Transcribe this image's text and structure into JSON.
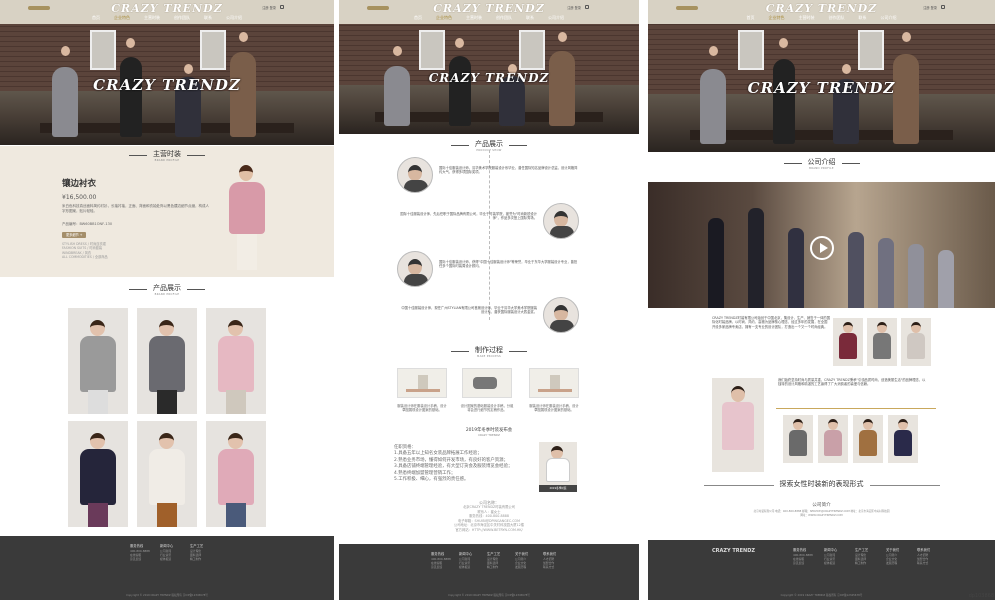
{
  "brand": "CRAZY TRENDZ",
  "nav": {
    "utility": "注册   登录",
    "items": [
      "首页",
      "企业特色",
      "主营时装",
      "创作团队",
      "联系",
      "公司介绍"
    ]
  },
  "hero_title": "CRAZY TRENDZ",
  "page1": {
    "main_section": {
      "title": "主营时装",
      "subtitle": "BRAND PROFILE"
    },
    "product": {
      "name": "镶边衬衣",
      "price": "¥16,500.00",
      "description": "米白色科技真丝面料简约衬衫，长袖衬袖，正面、背面和衣袖处饰以黑色镶边细节点缀，构成人字形图案，贴片轻轻。",
      "code": "产品编号：BW60BB1ONF-130",
      "button": "更多细节 +",
      "specs": "STYLISH DRESS / 时尚连衣裙\nFASHION SUITS / 时尚套装\nWINDBREAK / 风衣\nALL COMMODITIES / 全部商品"
    },
    "products_section": {
      "title": "产品展示",
      "subtitle": "BRAND PROFILE"
    }
  },
  "page2": {
    "products_section": {
      "title": "产品展示",
      "subtitle": "PRODUCT SHOW"
    },
    "items": [
      "国际十佳服装设计师，清华美术学院服装设计系毕业，曾任国际知名品牌设计总监，设计风格简约大气，获得多项国际奖项。",
      "国际十佳服装设计师，先后任职于国际品牌有限公司，毕业于时装学院，被誉为\"时尚新锐设计师\"，作品多次登上国际秀场。",
      "国际十佳服装设计师，获得\"中国十佳服装设计师\"等荣誉，毕业于东华大学服装设计专业，曾担任多个国际时装周设计顾问。",
      "中国十佳服装设计师，现任广州STYLIAN有限公司首席设计师，毕业于清华大学美术学院服装设计系，曾获国际服装设计大赛金奖。"
    ],
    "process_section": {
      "title": "制作过程",
      "subtitle": "MAKE PROCESS"
    },
    "process_captions": [
      "服装设计师在服装设计手稿，设计草图展现设计图案的基础。",
      "设计图案的基础服装设计手稿，分组将会进行细节的定稿作品。",
      "服装设计师在服装设计手稿，设计草图展现设计图案的基础。"
    ],
    "hiring": {
      "title": "2019年冬季时装发布会",
      "subtitle": "CRAZY TRENDZ",
      "lines": [
        "任职资格：",
        "1.具备五年以上知名女装品牌拓展工作经验；",
        "2.熟悉业务市场，懂得如何开发市场，有良好的客户资源；",
        "3.具备店铺终端管理经验，有大型订货会及服装博览会经验；",
        "4.熟悉终端加盟管理营销工作；",
        "5.工作积极、细心，有强烈的责任感。"
      ],
      "mini_caption": "2019冬季时装"
    },
    "contact": {
      "title": "公司名称：",
      "lines": [
        "北京CRAZY TRENDZ时装有限公司",
        "联系人：崔女士",
        "服务热线：400-800-8888",
        "电子邮箱：SHUIBI@DPINGANGEC.COM",
        "公司地址：北京市海淀区中关村科技园大厦12楼",
        "官方网站：HTTP://WWW.BETRYN.COM.HK/"
      ]
    }
  },
  "page3": {
    "about_section": {
      "title": "公司介绍",
      "subtitle": "BRAND PROFILE"
    },
    "about_text_1": "CRAZY TRENDZ时装有限公司始创于中国北京，集设计、生产、销售于一体的国际化时装品牌，以时尚、简约、高雅为品牌核心理念，经过多年的发展，在全国开设多家品牌专卖店，拥有一支专业的设计团队，打造出一个又一个时尚经典。",
    "about_text_2": "我们始终坚持时尚与质量并重，CRAZY TRENDZ秉承\"引领品质时尚，创造美丽生活\"的品牌理念，以独特的设计风格和精湛的工艺赢得了广大消费者的喜爱与信赖。",
    "explore": "探索女性时装新的表现形式",
    "company_info": "公司简介",
    "company_detail": "北京时装有限公司  电话：400-800-8888  邮箱：SERVICE@CRAZYTRENDZ.COM  地址：北京市海淀区中关村科技园\n网址：WWW.CRAZYTRENDZ.COM"
  },
  "footer": {
    "columns": [
      {
        "head": "服务热线",
        "links": [
          "400-800-8888",
          "在线客服",
          "意见反馈"
        ]
      },
      {
        "head": "新闻中心",
        "links": [
          "公司新闻",
          "行业资讯",
          "媒体报道"
        ]
      },
      {
        "head": "生产工艺",
        "links": [
          "设计理念",
          "面料选择",
          "精工制作"
        ]
      },
      {
        "head": "关于我们",
        "links": [
          "公司简介",
          "企业文化",
          "发展历程"
        ]
      },
      {
        "head": "联系我们",
        "links": [
          "人才招聘",
          "加盟合作",
          "联系方式"
        ]
      }
    ],
    "brand": "CRAZY TRENDZ",
    "copyright": "Copyright © 2019 CRAZY TRENDZ 版权所有  京ICP备12345678号"
  },
  "watermark": "dp103868",
  "colors": {
    "accent": "#a88c3c",
    "nav_bg": "#d8d2c4",
    "footer_bg": "#3a3a3a"
  }
}
